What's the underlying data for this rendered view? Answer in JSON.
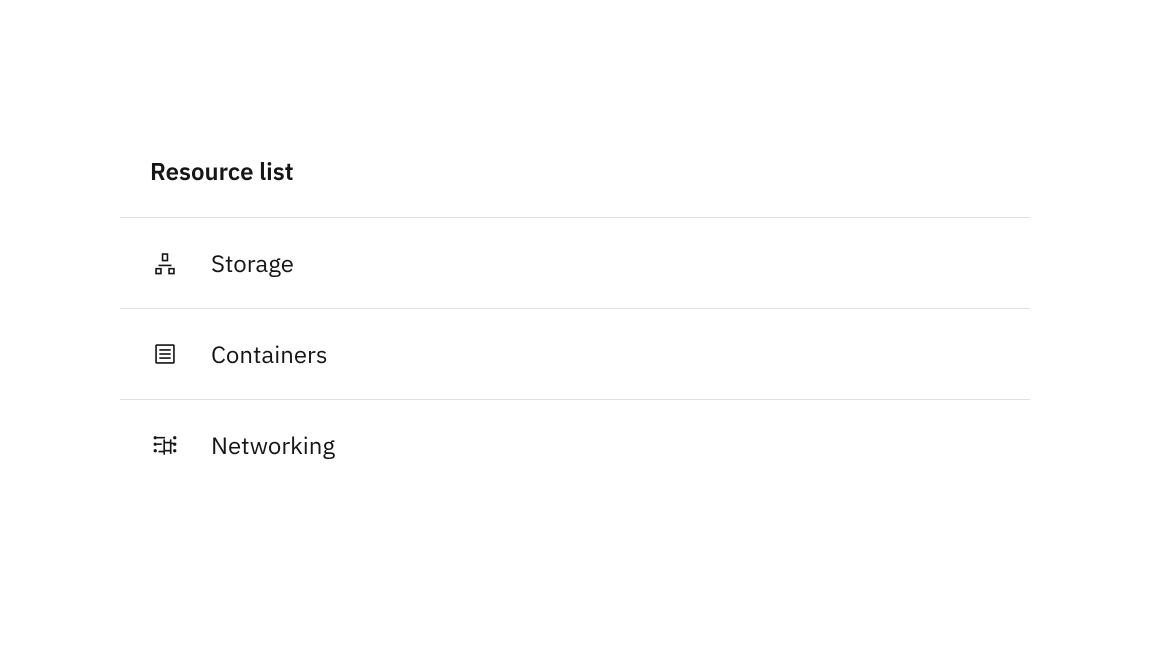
{
  "list": {
    "title": "Resource list",
    "items": [
      {
        "label": "Storage"
      },
      {
        "label": "Containers"
      },
      {
        "label": "Networking"
      }
    ]
  }
}
